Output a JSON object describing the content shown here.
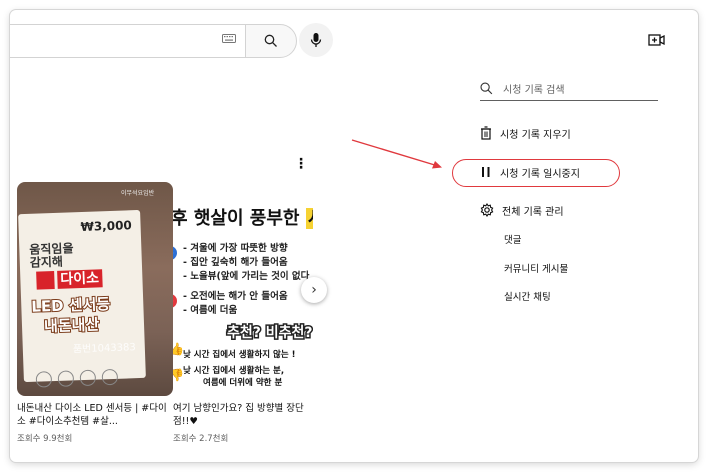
{
  "search": {
    "keyboard_icon": "keyboard-icon",
    "search_icon": "search-icon",
    "mic_icon": "mic-icon",
    "create_icon": "create-video-icon"
  },
  "videos": [
    {
      "thumbnail_texts": {
        "tag": "이무석요임반",
        "price": "₩3,000",
        "hand_text_1": "움직임을",
        "hand_text_2": "감지해",
        "brand": "다이소",
        "led_line_1": "LED 센서등",
        "led_line_2": "내돈내산",
        "code": "품번1043383"
      },
      "title": "내돈내산 다이소 LED 센서등 | #다이소 #다이소추천템 #살...",
      "views": "조회수 9.9천회"
    },
    {
      "thumbnail_texts": {
        "headline_prefix": "후 햇살이 풍부한",
        "headline_highlight": "서",
        "line_1": "- 겨울에 가장 따뜻한 방향",
        "line_2": "- 집안 깊숙히 해가 들어옴",
        "line_3": "- 노을뷰(앞에 가리는 것이 없다",
        "line_4": "- 오전에는 해가 안 들어옴",
        "line_5": "- 여름에 더움",
        "badge": "추천? 비추천?",
        "q_1": "낮 시간 집에서 생활하지 않는 !",
        "q_2": "낮 시간 집에서 생활하는 분,",
        "q_3": "여름에 더위에 약한 분"
      },
      "title": "여기 남향인가요? 집 방향별 장단점!!♥",
      "views": "조회수 2.7천회"
    }
  ],
  "history_menu": {
    "search_placeholder": "시청 기록 검색",
    "clear_label": "시청 기록 지우기",
    "pause_label": "시청 기록 일시중지",
    "manage_label": "전체 기록 관리",
    "sub_items": [
      "댓글",
      "커뮤니티 게시물",
      "실시간 채팅"
    ]
  },
  "colors": {
    "highlight_red": "#e0393e",
    "daiso_red": "#d8232a",
    "thumb_yellow": "#f6d232"
  }
}
